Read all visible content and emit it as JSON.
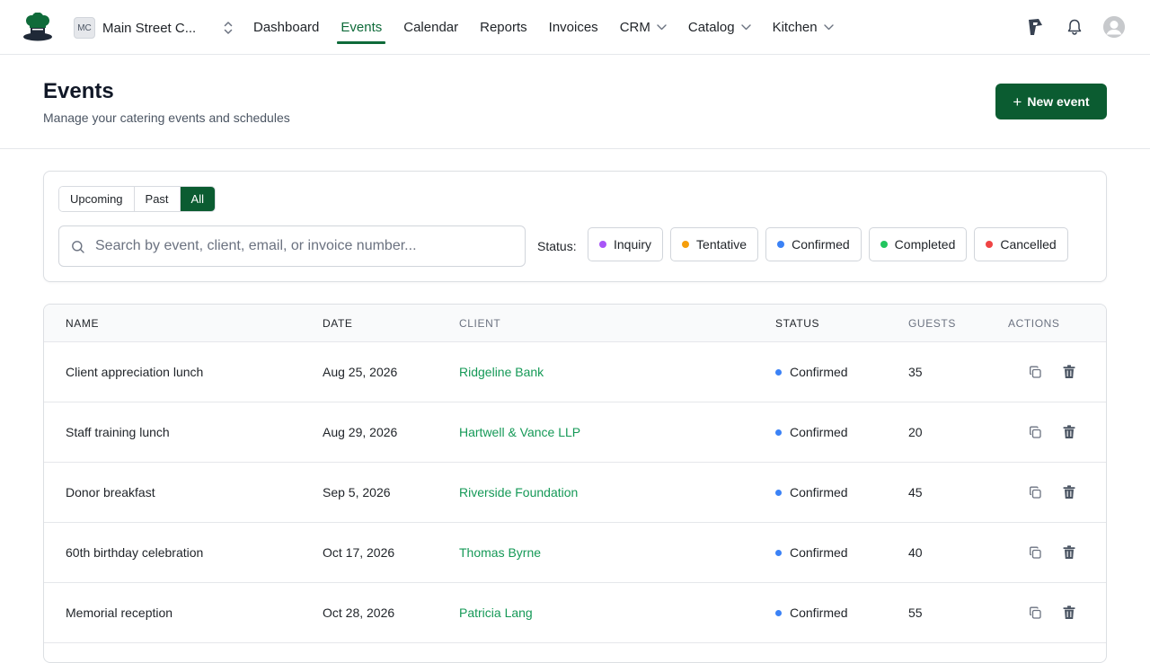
{
  "nav": {
    "org_initials": "MC",
    "org_name": "Main Street C...",
    "links": [
      {
        "label": "Dashboard"
      },
      {
        "label": "Events",
        "active": true
      },
      {
        "label": "Calendar"
      },
      {
        "label": "Reports"
      },
      {
        "label": "Invoices"
      },
      {
        "label": "CRM",
        "dropdown": true
      },
      {
        "label": "Catalog",
        "dropdown": true
      },
      {
        "label": "Kitchen",
        "dropdown": true
      }
    ],
    "icons": [
      "chef-hat-logo-icon",
      "chevron-up-down-icon",
      "brand-flag-icon",
      "bell-icon",
      "user-avatar"
    ]
  },
  "header": {
    "title": "Events",
    "subtitle": "Manage your catering events and schedules",
    "new_button": "New event"
  },
  "filters": {
    "segments": [
      {
        "label": "Upcoming"
      },
      {
        "label": "Past"
      },
      {
        "label": "All",
        "active": true
      }
    ],
    "search_placeholder": "Search by event, client, email, or invoice number...",
    "status_label": "Status:",
    "statuses": [
      {
        "label": "Inquiry",
        "color": "#a855f7"
      },
      {
        "label": "Tentative",
        "color": "#f59e0b"
      },
      {
        "label": "Confirmed",
        "color": "#3b82f6"
      },
      {
        "label": "Completed",
        "color": "#22c55e"
      },
      {
        "label": "Cancelled",
        "color": "#ef4444"
      }
    ]
  },
  "table": {
    "columns": [
      "NAME",
      "DATE",
      "CLIENT",
      "STATUS",
      "GUESTS",
      "ACTIONS"
    ],
    "rows": [
      {
        "name": "Client appreciation lunch",
        "date": "Aug 25, 2026",
        "client": "Ridgeline Bank",
        "status": "Confirmed",
        "guests": "35"
      },
      {
        "name": "Staff training lunch",
        "date": "Aug 29, 2026",
        "client": "Hartwell & Vance LLP",
        "status": "Confirmed",
        "guests": "20"
      },
      {
        "name": "Donor breakfast",
        "date": "Sep 5, 2026",
        "client": "Riverside Foundation",
        "status": "Confirmed",
        "guests": "45"
      },
      {
        "name": "60th birthday celebration",
        "date": "Oct 17, 2026",
        "client": "Thomas Byrne",
        "status": "Confirmed",
        "guests": "40"
      },
      {
        "name": "Memorial reception",
        "date": "Oct 28, 2026",
        "client": "Patricia Lang",
        "status": "Confirmed",
        "guests": "55"
      }
    ]
  },
  "colors": {
    "brand_green": "#0b5c31",
    "link_green": "#159957",
    "confirmed_blue": "#3b82f6"
  }
}
